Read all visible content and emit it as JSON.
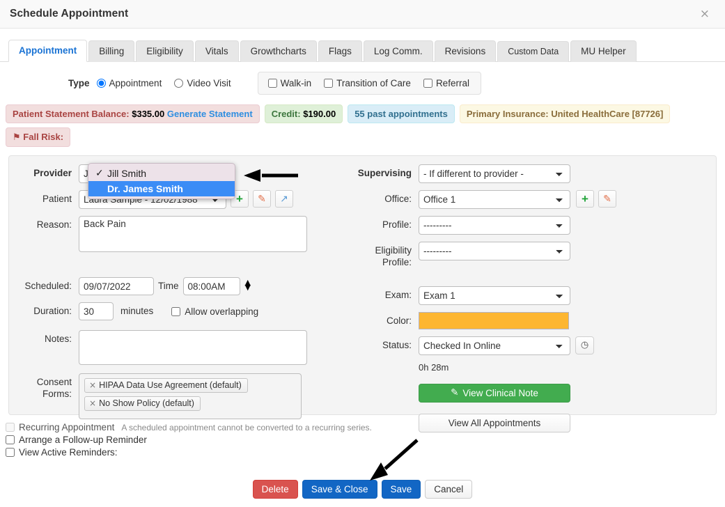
{
  "window": {
    "title": "Schedule Appointment",
    "close_label": "×"
  },
  "tabs": [
    {
      "label": "Appointment",
      "active": true
    },
    {
      "label": "Billing",
      "active": false
    },
    {
      "label": "Eligibility",
      "active": false
    },
    {
      "label": "Vitals",
      "active": false
    },
    {
      "label": "Growthcharts",
      "active": false
    },
    {
      "label": "Flags",
      "active": false
    },
    {
      "label": "Log Comm.",
      "active": false
    },
    {
      "label": "Revisions",
      "active": false
    },
    {
      "label": "Custom Data",
      "active": false
    },
    {
      "label": "MU Helper",
      "active": false
    }
  ],
  "type_row": {
    "label": "Type",
    "radios": [
      {
        "label": "Appointment",
        "checked": true
      },
      {
        "label": "Video Visit",
        "checked": false
      }
    ],
    "checkboxes": [
      {
        "label": "Walk-in",
        "checked": false
      },
      {
        "label": "Transition of Care",
        "checked": false
      },
      {
        "label": "Referral",
        "checked": false
      }
    ]
  },
  "badges": {
    "statement_label": "Patient Statement Balance:",
    "statement_amount": "$335.00",
    "generate_statement": "Generate Statement",
    "credit_label": "Credit:",
    "credit_amount": "$190.00",
    "past_appointments": "55 past appointments",
    "primary_insurance": "Primary Insurance: United HealthCare [87726]",
    "fall_risk": "Fall Risk:",
    "fall_risk_icon": "⚑"
  },
  "left": {
    "provider_label": "Provider",
    "provider_value": "Jill Smith",
    "provider_dropdown": [
      {
        "label": "Jill Smith",
        "checkmark": "✓",
        "selected": false
      },
      {
        "label": "Dr. James Smith",
        "checkmark": "",
        "selected": true
      }
    ],
    "patient_label": "Patient",
    "patient_value": "Laura Sample - 12/02/1988",
    "patient_add_icon": "+",
    "patient_edit_icon": "✎",
    "patient_share_icon": "↗",
    "reason_label": "Reason:",
    "reason_value": "Back Pain",
    "scheduled_label": "Scheduled:",
    "scheduled_value": "09/07/2022",
    "time_label": "Time",
    "time_value": "08:00AM",
    "duration_label": "Duration:",
    "duration_value": "30",
    "minutes_label": "minutes",
    "allow_overlapping_label": "Allow overlapping",
    "allow_overlapping_checked": false,
    "notes_label": "Notes:",
    "notes_value": "",
    "consent_label_1": "Consent",
    "consent_label_2": "Forms:",
    "consent_chips": [
      {
        "remove": "×",
        "label": "HIPAA Data Use Agreement (default)"
      },
      {
        "remove": "×",
        "label": "No Show Policy (default)"
      }
    ]
  },
  "right": {
    "supervising_label": "Supervising",
    "supervising_value": "- If different to provider -",
    "office_label": "Office:",
    "office_value": "Office 1",
    "office_add_icon": "+",
    "office_edit_icon": "✎",
    "profile_label": "Profile:",
    "profile_value": "---------",
    "eligibility_label_1": "Eligibility",
    "eligibility_label_2": "Profile:",
    "eligibility_value": "---------",
    "exam_label": "Exam:",
    "exam_value": "Exam 1",
    "color_label": "Color:",
    "color_value": "#fdb631",
    "status_label": "Status:",
    "status_value": "Checked In Online",
    "status_clock_icon": "◷",
    "elapsed_time": "0h 28m",
    "view_clinical_note": "View Clinical Note",
    "view_clinical_note_icon": "✎",
    "view_all_appointments": "View All Appointments"
  },
  "bottom": {
    "recurring_label": "Recurring Appointment",
    "recurring_note": "A scheduled appointment cannot be converted to a recurring series.",
    "recurring_checked": false,
    "followup_label": "Arrange a Follow-up Reminder",
    "followup_checked": false,
    "view_reminders_label": "View Active Reminders:",
    "view_reminders_checked": false
  },
  "footer": {
    "delete": "Delete",
    "save_close": "Save & Close",
    "save": "Save",
    "cancel": "Cancel"
  }
}
